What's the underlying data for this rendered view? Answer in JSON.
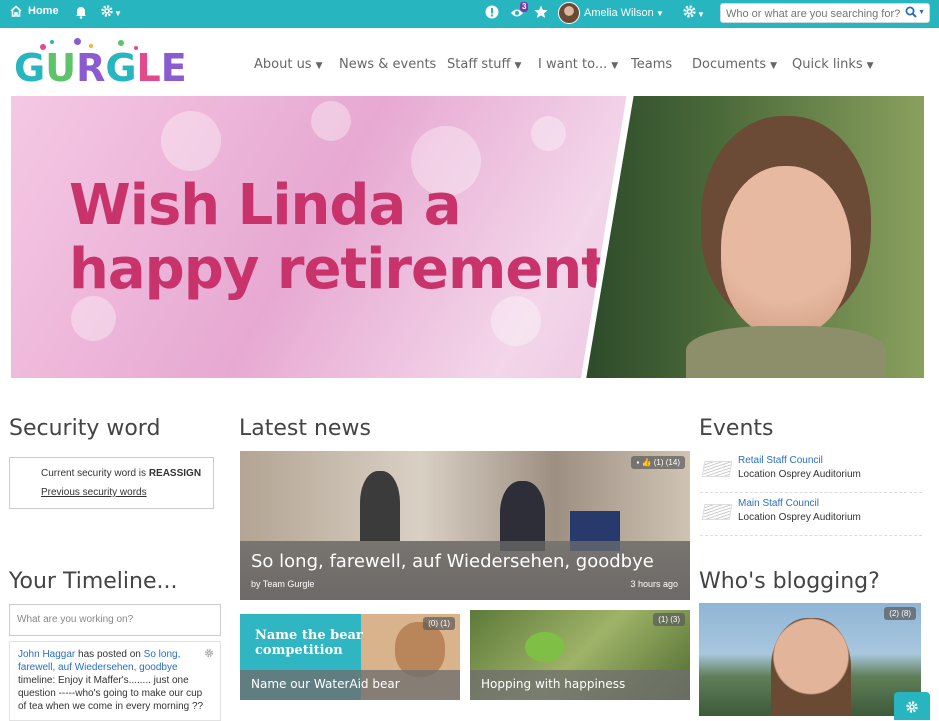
{
  "topbar": {
    "home_label": "Home",
    "notification_count": "3",
    "user_name": "Amelia Wilson",
    "search_placeholder": "Who or what are you searching for?..."
  },
  "logo": {
    "text": "GURGLE"
  },
  "nav": {
    "items": [
      {
        "label": "About us",
        "has_menu": true
      },
      {
        "label": "News & events",
        "has_menu": false
      },
      {
        "label": "Staff stuff",
        "has_menu": true
      },
      {
        "label": "I want to...",
        "has_menu": true
      },
      {
        "label": "Teams",
        "has_menu": false
      },
      {
        "label": "Documents",
        "has_menu": true
      },
      {
        "label": "Quick links",
        "has_menu": true
      }
    ]
  },
  "banner": {
    "line1": "Wish Linda a",
    "line2": "happy retirement"
  },
  "security": {
    "heading": "Security word",
    "prefix": "Current security word is",
    "word": "REASSIGN",
    "link": "Previous security words"
  },
  "timeline": {
    "heading": "Your Timeline...",
    "input_placeholder": "What are you working on?",
    "post": {
      "author": "John Haggar",
      "verb": " has posted on ",
      "target": "So long, farewell, auf Wiedersehen, goodbye",
      "body": " timeline: Enjoy it Maffer's........ just one question -----who's going to make our cup of tea when we come in every morning ??"
    }
  },
  "news": {
    "heading": "Latest news",
    "main": {
      "title": "So long, farewell, auf Wiedersehen, goodbye",
      "byline": "by Team Gurgle",
      "time": "3 hours ago",
      "stats": "(1) (14)"
    },
    "cards": [
      {
        "title": "Name our WaterAid bear",
        "stats": "(0) (1)",
        "image_text_1": "Name the bear",
        "image_text_2": "competition"
      },
      {
        "title": "Hopping with happiness",
        "stats": "(1) (3)"
      }
    ]
  },
  "events": {
    "heading": "Events",
    "items": [
      {
        "title": "Retail Staff Council",
        "location": "Location Osprey Auditorium"
      },
      {
        "title": "Main Staff Council",
        "location": "Location Osprey Auditorium"
      }
    ]
  },
  "blogging": {
    "heading": "Who's blogging?",
    "stats": "(2) (8)"
  },
  "colors": {
    "topbar": "#27b5bf",
    "headline": "#c8336b",
    "link": "#2a6fbd"
  }
}
